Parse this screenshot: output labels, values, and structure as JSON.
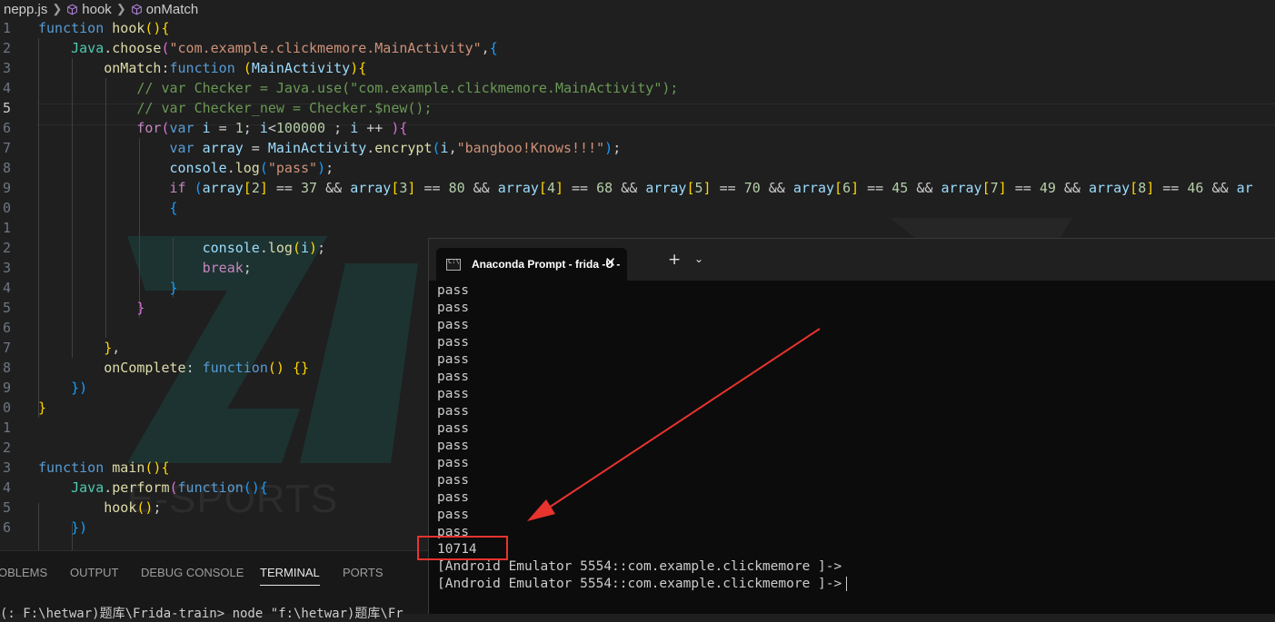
{
  "breadcrumb": {
    "file": "nepp.js",
    "items": [
      "hook",
      "onMatch"
    ]
  },
  "editor": {
    "line_numbers": [
      "1",
      "2",
      "3",
      "4",
      "5",
      "6",
      "7",
      "8",
      "9",
      "0",
      "1",
      "2",
      "3",
      "4",
      "5",
      "6",
      "7",
      "8",
      "9",
      "0",
      "1",
      "2",
      "3",
      "4",
      "5",
      "6"
    ],
    "active_line_index": 4
  },
  "watermark": {
    "text": "E-SPORTS"
  },
  "panel": {
    "tabs": [
      "OBLEMS",
      "OUTPUT",
      "DEBUG CONSOLE",
      "TERMINAL",
      "PORTS"
    ],
    "active_tab": "TERMINAL",
    "prompt_line": "(: F:\\hetwar)题库\\Frida-train> node \"f:\\hetwar)题库\\Fr"
  },
  "terminal": {
    "tab_title": "Anaconda Prompt - frida  -U -",
    "close_glyph": "✕",
    "new_tab_glyph": "+",
    "dropdown_glyph": "⌄",
    "output_lines": [
      "pass",
      "pass",
      "pass",
      "pass",
      "pass",
      "pass",
      "pass",
      "pass",
      "pass",
      "pass",
      "pass",
      "pass",
      "pass",
      "pass",
      "pass"
    ],
    "result": "10714",
    "prompt_lines": [
      "[Android Emulator 5554::com.example.clickmemore ]->",
      "[Android Emulator 5554::com.example.clickmemore ]->"
    ]
  },
  "icons": {
    "breadcrumb_symbol": "cube-icon",
    "breadcrumb_separator": "chevron-right-icon",
    "terminal_tab": "cmd-icon"
  },
  "colors": {
    "annotation": "#e8332f",
    "editor_bg": "#1f1f1f",
    "terminal_bg": "#0c0c0c"
  }
}
